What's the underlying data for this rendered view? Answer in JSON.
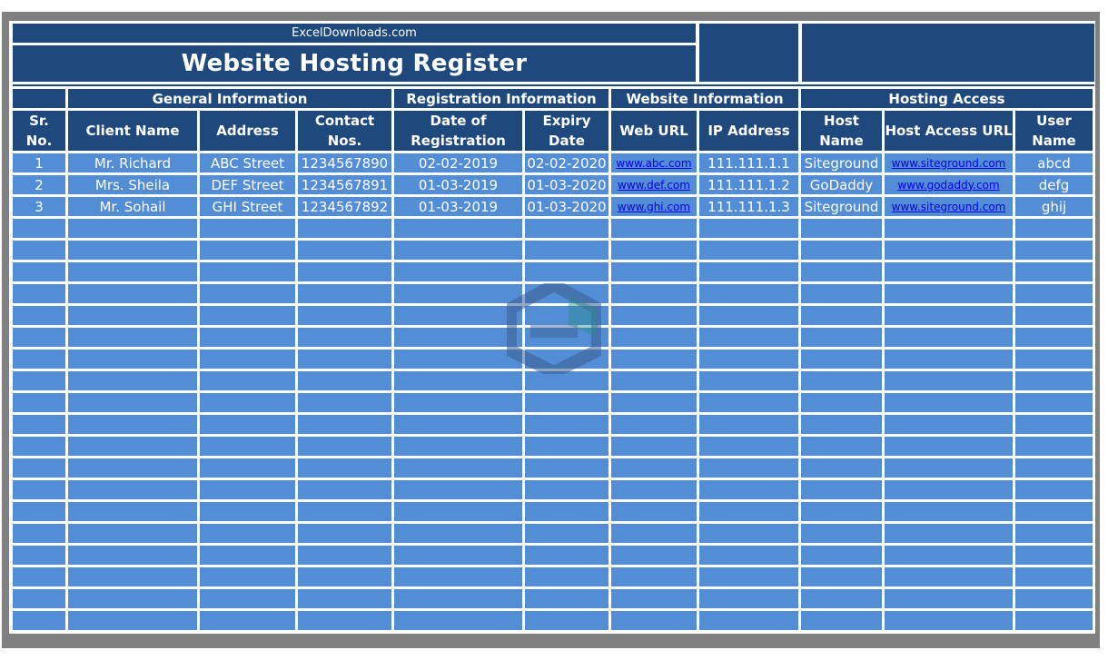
{
  "header": {
    "site": "ExcelDownloads.com",
    "title": "Website Hosting Register"
  },
  "groups": [
    {
      "label": ""
    },
    {
      "label": "General Information"
    },
    {
      "label": "Registration Information"
    },
    {
      "label": "Website Information"
    },
    {
      "label": "Hosting Access"
    }
  ],
  "columns": [
    {
      "label": "Sr. No."
    },
    {
      "label": "Client Name"
    },
    {
      "label": "Address"
    },
    {
      "label": "Contact Nos."
    },
    {
      "label": "Date of Registration"
    },
    {
      "label": "Expiry Date"
    },
    {
      "label": "Web URL"
    },
    {
      "label": "IP Address"
    },
    {
      "label": "Host Name"
    },
    {
      "label": "Host Access URL"
    },
    {
      "label": "User Name"
    }
  ],
  "rows": [
    [
      "1",
      "Mr. Richard",
      "ABC Street",
      "1234567890",
      "02-02-2019",
      "02-02-2020",
      "www.abc.com",
      "111.111.1.1",
      "Siteground",
      "www.siteground.com",
      "abcd"
    ],
    [
      "2",
      "Mrs. Sheila",
      "DEF Street",
      "1234567891",
      "01-03-2019",
      "01-03-2020",
      "www.def.com",
      "111.111.1.2",
      "GoDaddy",
      "www.godaddy.com",
      "defg"
    ],
    [
      "3",
      "Mr. Sohail",
      "GHI Street",
      "1234567892",
      "01-03-2019",
      "01-03-2020",
      "www.ghi.com",
      "111.111.1.3",
      "Siteground",
      "www.siteground.com",
      "ghij"
    ]
  ],
  "empty_row_count": 19,
  "link_columns": [
    6,
    9
  ],
  "colors": {
    "header_bg": "#1f497d",
    "cell_bg": "#538dd5",
    "link": "#0000ee",
    "frame": "#808080"
  },
  "watermark": {
    "icon": "exceldownloads-logo-icon"
  }
}
